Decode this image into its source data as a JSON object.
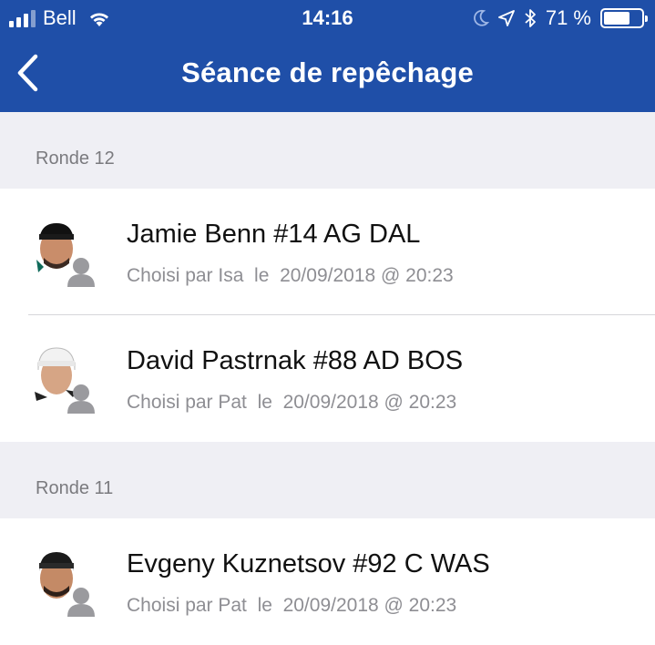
{
  "status_bar": {
    "carrier": "Bell",
    "time": "14:16",
    "battery_percent": "71 %",
    "battery_level": 0.71
  },
  "header": {
    "title": "Séance de repêchage",
    "back_icon": "chevron-left-icon"
  },
  "colors": {
    "header_bg": "#1f4fa8",
    "section_bg": "#efeff4",
    "secondary_text": "#8e8e93"
  },
  "sections": [
    {
      "label": "Ronde 12",
      "picks": [
        {
          "player": "Jamie Benn #14 AG DAL",
          "by_label": "Choisi par Isa  le  20/09/2018 @ 20:23"
        },
        {
          "player": "David Pastrnak #88 AD BOS",
          "by_label": "Choisi par Pat  le  20/09/2018 @ 20:23"
        }
      ]
    },
    {
      "label": "Ronde 11",
      "picks": [
        {
          "player": "Evgeny Kuznetsov #92 C WAS",
          "by_label": "Choisi par Pat  le  20/09/2018 @ 20:23"
        }
      ]
    }
  ]
}
